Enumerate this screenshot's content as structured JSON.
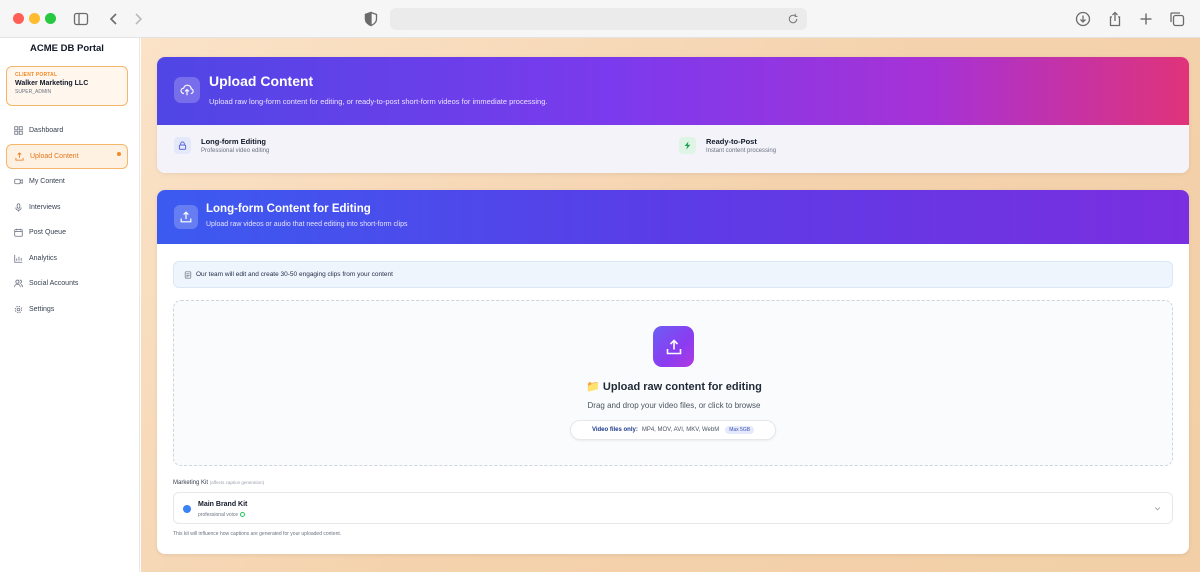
{
  "app": {
    "portal_title": "ACME DB Portal"
  },
  "client": {
    "label": "CLIENT PORTAL",
    "name": "Walker Marketing LLC",
    "role": "SUPER_ADMIN"
  },
  "sidebar": {
    "items": [
      {
        "label": "Dashboard",
        "icon": "grid-icon"
      },
      {
        "label": "Upload Content",
        "icon": "upload-icon",
        "active": true
      },
      {
        "label": "My Content",
        "icon": "video-icon"
      },
      {
        "label": "Interviews",
        "icon": "mic-icon"
      },
      {
        "label": "Post Queue",
        "icon": "calendar-icon"
      },
      {
        "label": "Analytics",
        "icon": "chart-icon"
      },
      {
        "label": "Social Accounts",
        "icon": "users-icon"
      },
      {
        "label": "Settings",
        "icon": "gear-icon"
      }
    ]
  },
  "hero": {
    "title": "Upload Content",
    "subtitle": "Upload raw long-form content for editing, or ready-to-post short-form videos for immediate processing.",
    "features": [
      {
        "title": "Long-form Editing",
        "subtitle": "Professional video editing"
      },
      {
        "title": "Ready-to-Post",
        "subtitle": "Instant content processing"
      }
    ]
  },
  "upload": {
    "title": "Long-form Content for Editing",
    "subtitle": "Upload raw videos or audio that need editing into short-form clips",
    "notice": "Our team will edit and create 30-50 engaging clips from your content",
    "dropzone_title": "📁 Upload raw content for editing",
    "dropzone_sub": "Drag and drop your video files, or click to browse",
    "formats_label": "Video files only:",
    "formats": "MP4, MOV, AVI, MKV, WebM",
    "max_size": "Max 5GB"
  },
  "marketing_kit": {
    "label": "Marketing Kit",
    "label_note": "(affects caption generation)",
    "selected_name": "Main Brand Kit",
    "selected_voice": "professional voice",
    "help_text": "This kit will influence how captions are generated for your uploaded content.",
    "dot_color": "#3b82f6"
  },
  "colors": {
    "accent_orange": "#f08a24",
    "hero_gradient_start": "#4f46e5",
    "hero_gradient_end": "#e0337a"
  }
}
